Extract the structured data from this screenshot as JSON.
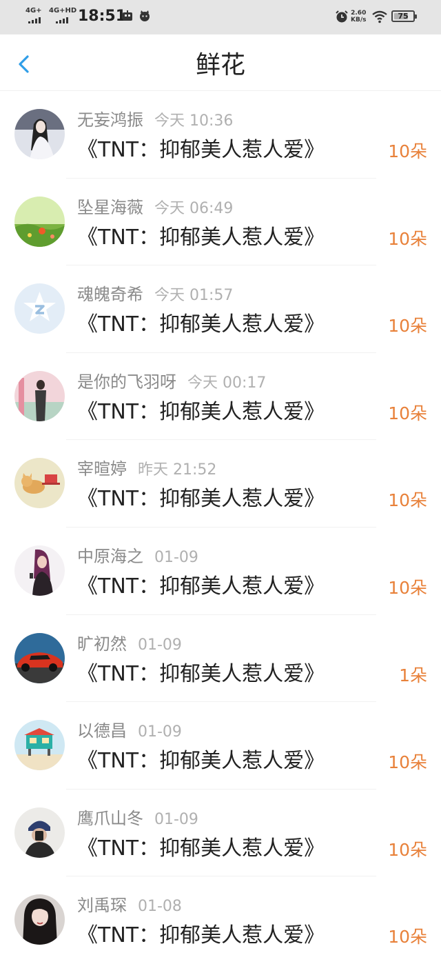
{
  "status_bar": {
    "net1": "4G+",
    "net2": "4G+HD",
    "time": "18:51",
    "speed_value": "2.60",
    "speed_unit": "KB/s",
    "battery": "75",
    "battery_level": 0.75
  },
  "header": {
    "title": "鲜花",
    "back_icon": "chevron-left-icon"
  },
  "colors": {
    "accent": "#2f9ee8",
    "count": "#e8813a",
    "name": "#8a8a8a",
    "time": "#b0b0b0"
  },
  "items": [
    {
      "name": "无妄鸿振",
      "time": "今天 10:36",
      "book": "《TNT：抑郁美人惹人爱》",
      "count": "10朵"
    },
    {
      "name": "坠星海薇",
      "time": "今天 06:49",
      "book": "《TNT：抑郁美人惹人爱》",
      "count": "10朵"
    },
    {
      "name": "魂魄奇希",
      "time": "今天 01:57",
      "book": "《TNT：抑郁美人惹人爱》",
      "count": "10朵"
    },
    {
      "name": "是你的飞羽呀",
      "time": "今天 00:17",
      "book": "《TNT：抑郁美人惹人爱》",
      "count": "10朵"
    },
    {
      "name": "宰暄婷",
      "time": "昨天 21:52",
      "book": "《TNT：抑郁美人惹人爱》",
      "count": "10朵"
    },
    {
      "name": "中原海之",
      "time": "01-09",
      "book": "《TNT：抑郁美人惹人爱》",
      "count": "10朵"
    },
    {
      "name": "旷初然",
      "time": "01-09",
      "book": "《TNT：抑郁美人惹人爱》",
      "count": "1朵"
    },
    {
      "name": "以德昌",
      "time": "01-09",
      "book": "《TNT：抑郁美人惹人爱》",
      "count": "10朵"
    },
    {
      "name": "鹰爪山冬",
      "time": "01-09",
      "book": "《TNT：抑郁美人惹人爱》",
      "count": "10朵"
    },
    {
      "name": "刘禹琛",
      "time": "01-08",
      "book": "《TNT：抑郁美人惹人爱》",
      "count": "10朵"
    }
  ]
}
